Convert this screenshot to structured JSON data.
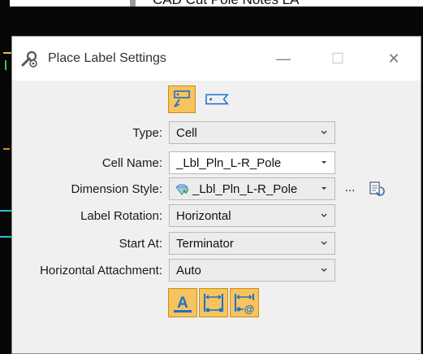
{
  "background": {
    "partial_text": "CAD Cut Pole Notes LA"
  },
  "dialog": {
    "title": "Place Label Settings",
    "buttons": {
      "minimize": "—",
      "maximize": "☐",
      "close": "✕"
    },
    "mode_buttons": [
      {
        "name": "place-label-mode",
        "icon": "label-leader-icon",
        "active": true
      },
      {
        "name": "place-tag-mode",
        "icon": "tag-icon",
        "active": false
      }
    ],
    "fields": {
      "type": {
        "label": "Type:",
        "value": "Cell"
      },
      "cell_name": {
        "label": "Cell Name:",
        "value": "_Lbl_Pln_L-R_Pole"
      },
      "dimension_style": {
        "label": "Dimension Style:",
        "value": "_Lbl_Pln_L-R_Pole",
        "ellipsis": "..."
      },
      "label_rotation": {
        "label": "Label Rotation:",
        "value": "Horizontal"
      },
      "start_at": {
        "label": "Start At:",
        "value": "Terminator"
      },
      "horizontal_attachment": {
        "label": "Horizontal Attachment:",
        "value": "Auto"
      }
    },
    "bottom_tools": [
      {
        "name": "text-label-tool",
        "icon": "text-a-icon",
        "glyph": "A",
        "active": true
      },
      {
        "name": "dimension-tool",
        "icon": "dimension-icon",
        "active": true
      },
      {
        "name": "dimension-at-tool",
        "icon": "dimension-at-icon",
        "glyph": "@",
        "active": true
      }
    ],
    "colors": {
      "active_button": "#f7c35c",
      "active_border": "#c98e1c",
      "icon_blue": "#1f6fd0"
    }
  }
}
